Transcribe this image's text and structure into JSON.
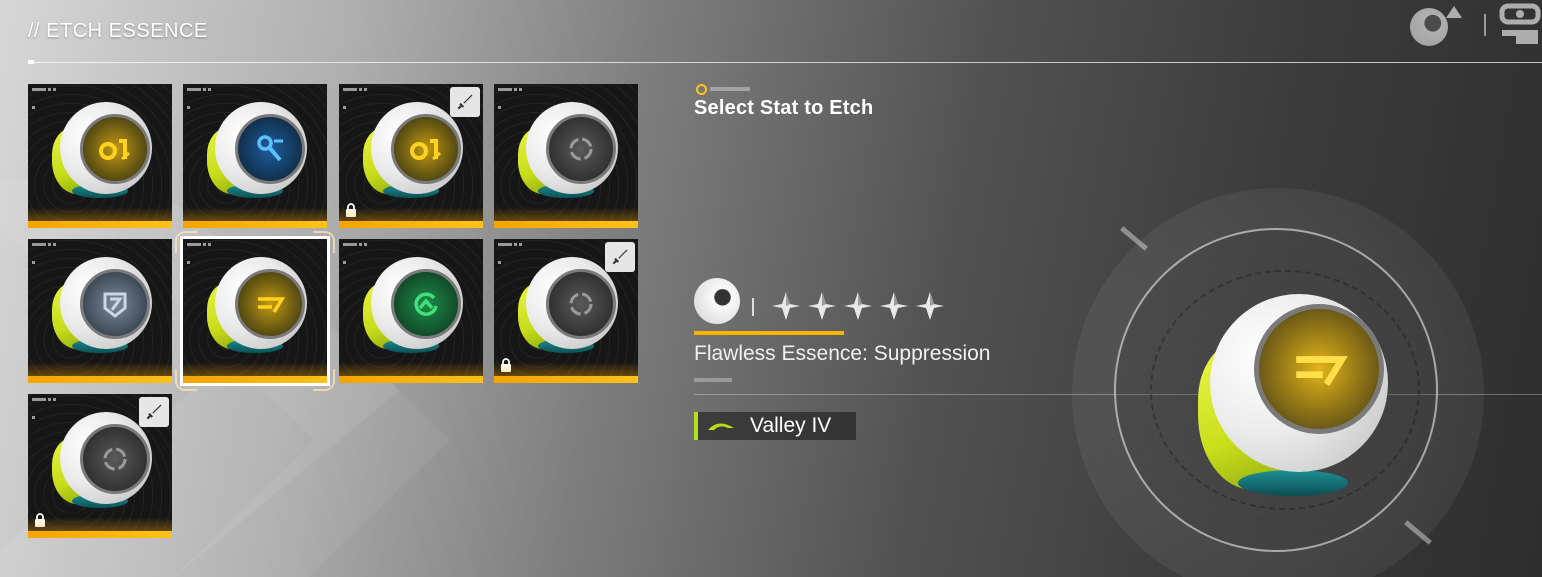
{
  "header": {
    "title": "// ETCH ESSENCE"
  },
  "grid": {
    "cards": [
      {
        "glyph": "ol",
        "face": "yellow",
        "locked": false,
        "sword": false,
        "selected": false
      },
      {
        "glyph": "key",
        "face": "blue",
        "locked": false,
        "sword": false,
        "selected": false
      },
      {
        "glyph": "ol",
        "face": "yellow",
        "locked": true,
        "sword": true,
        "selected": false
      },
      {
        "glyph": "ring",
        "face": "gray",
        "locked": false,
        "sword": false,
        "selected": false
      },
      {
        "glyph": "shield",
        "face": "silver",
        "locked": false,
        "sword": false,
        "selected": false
      },
      {
        "glyph": "suppression",
        "face": "yellow",
        "locked": false,
        "sword": false,
        "selected": true
      },
      {
        "glyph": "arrow-up",
        "face": "green",
        "locked": false,
        "sword": false,
        "selected": false
      },
      {
        "glyph": "ring",
        "face": "gray",
        "locked": true,
        "sword": true,
        "selected": false
      },
      {
        "glyph": "ring",
        "face": "gray",
        "locked": true,
        "sword": true,
        "selected": false
      }
    ]
  },
  "panel": {
    "heading": "Select Stat to Etch",
    "essence_name": "Flawless Essence: Suppression",
    "rarity_stars": 5,
    "region": "Valley IV"
  },
  "colors": {
    "accent_yellow": "#ffb500",
    "region_green": "#b6e01a",
    "rarity_bar": "#f5a400"
  },
  "icons": {
    "top_right": [
      "essence-orb-icon",
      "triangle-icon",
      "menu-robot-icon"
    ],
    "card_badge": "sword-icon",
    "card_lock": "lock-icon",
    "region": "leaf-icon"
  }
}
